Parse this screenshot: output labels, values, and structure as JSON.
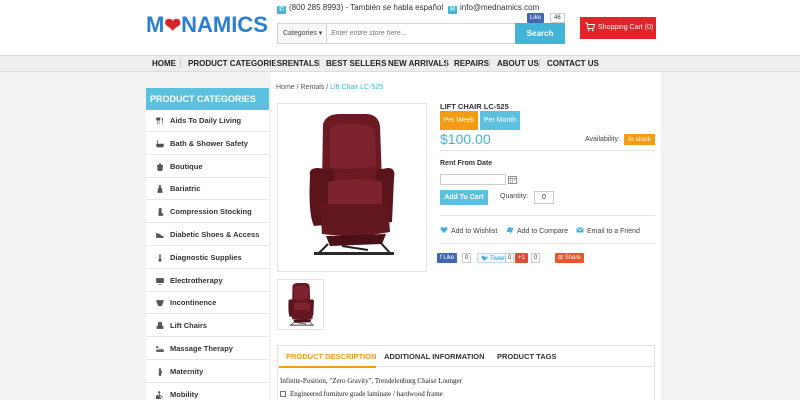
{
  "header": {
    "logo": {
      "m": "M",
      "e": "E",
      "rest": "NAMICS"
    },
    "phone": "(800 285 8993) - También se habla español",
    "email": "info@mednamics.com",
    "fb_like": "Like",
    "fb_count": "46",
    "search": {
      "category_label": "Categories",
      "placeholder": "Enter entire store here...",
      "button_label": "Search"
    },
    "cart_label": "Shopping Cart (0)"
  },
  "nav": {
    "items": [
      "HOME",
      "PRODUCT CATEGORIES",
      "RENTALS",
      "BEST SELLERS",
      "NEW ARRIVALS",
      "REPAIRS",
      "ABOUT US",
      "CONTACT US"
    ]
  },
  "sidebar": {
    "title": "PRODUCT CATEGORIES",
    "items": [
      {
        "label": "Aids To Daily Living",
        "icon": "utensils-icon"
      },
      {
        "label": "Bath & Shower Safety",
        "icon": "bathtub-icon"
      },
      {
        "label": "Boutique",
        "icon": "boutique-icon"
      },
      {
        "label": "Bariatric",
        "icon": "bariatric-icon"
      },
      {
        "label": "Compression Stocking",
        "icon": "stocking-icon"
      },
      {
        "label": "Diabetic Shoes & Access",
        "icon": "shoe-icon"
      },
      {
        "label": "Diagnostic Supplies",
        "icon": "thermometer-icon"
      },
      {
        "label": "Electrotherapy",
        "icon": "electrotherapy-icon"
      },
      {
        "label": "Incontinence",
        "icon": "incontinence-icon"
      },
      {
        "label": "Lift Chairs",
        "icon": "lift-chair-icon"
      },
      {
        "label": "Massage Therapy",
        "icon": "massage-icon"
      },
      {
        "label": "Maternity",
        "icon": "maternity-icon"
      },
      {
        "label": "Mobility",
        "icon": "wheelchair-icon"
      }
    ]
  },
  "breadcrumb": {
    "home": "Home",
    "sep1": " / ",
    "rentals": "Rentals",
    "sep2": " / ",
    "current": "Lift Chair LC-525"
  },
  "product": {
    "title": "LIFT CHAIR LC-525",
    "per_week": "Per Week",
    "per_month": "Per Month",
    "price": "$100.00",
    "availability_label": "Availability:",
    "availability_value": "In stock",
    "rent_from_label": "Rent From Date",
    "date_value": "",
    "add_to_cart": "Add To Cart",
    "quantity_label": "Quantity:",
    "quantity_value": "0",
    "actions": {
      "wishlist": "Add to Wishlist",
      "compare": "Add to Compare",
      "email": "Email to a Friend"
    },
    "social": {
      "like": "Like",
      "like_count": "0",
      "tweet": "Tweet",
      "tweet_count": "0",
      "gplus": "+1",
      "gplus_count": "0",
      "share": "Share"
    },
    "chair_color": "#6b1a22"
  },
  "tabs": {
    "items": [
      "PRODUCT DESCRIPTION",
      "ADDITIONAL INFORMATION",
      "PRODUCT TAGS"
    ],
    "active": 0
  },
  "description": {
    "line1": "Infinite-Position, \"Zero Gravity\", Trendelenburg Chaise Lounger",
    "line2": "Engineered furniture grade laminate / hardwood frame"
  },
  "colors": {
    "accent_blue": "#41b4d8",
    "sidebar_head": "#5cc1de",
    "orange": "#f39c12",
    "cart_red": "#e2232a"
  }
}
